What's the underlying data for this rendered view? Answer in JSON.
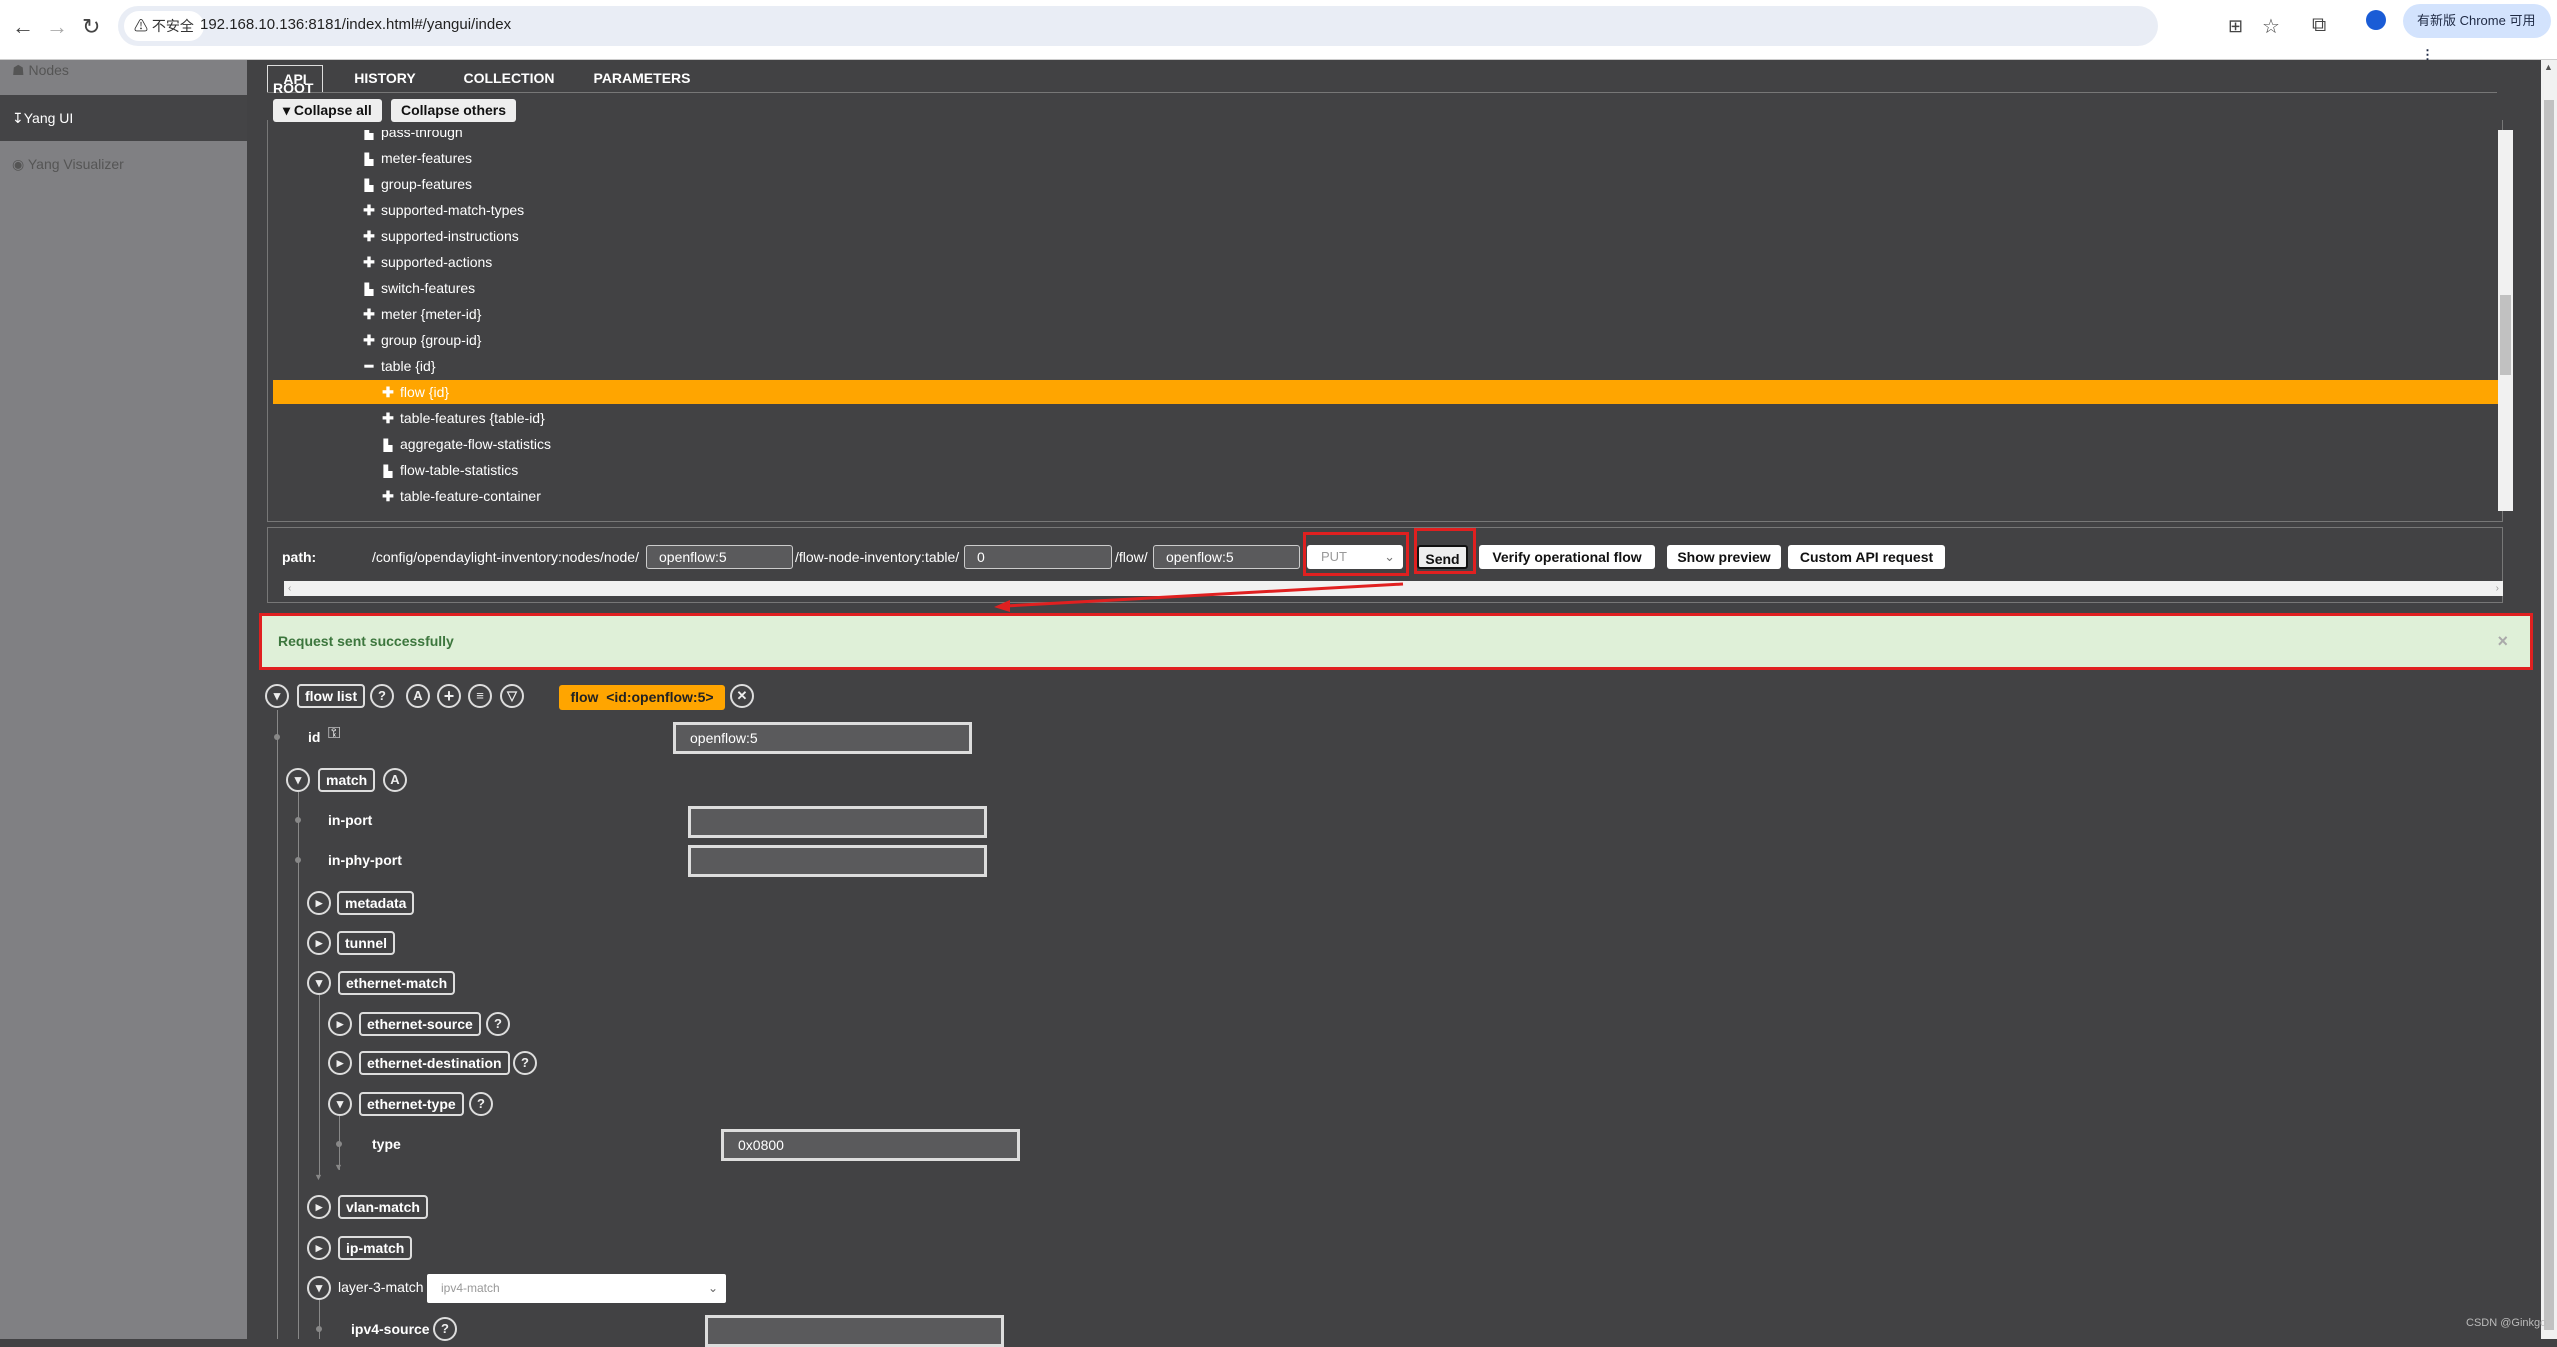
{
  "browser": {
    "security_label": "不安全",
    "url": "192.168.10.136:8181/index.html#/yangui/index",
    "update_label": "有新版 Chrome 可用"
  },
  "sidebar": {
    "items": [
      {
        "label": "Nodes",
        "icon": "sitemap-icon"
      },
      {
        "label": "Yang UI",
        "icon": "arrow-down-icon",
        "active": true
      },
      {
        "label": "Yang Visualizer",
        "icon": "eye-icon"
      }
    ]
  },
  "tabs": [
    "API",
    "HISTORY",
    "COLLECTION",
    "PARAMETERS"
  ],
  "tree": {
    "root_label": "ROOT",
    "collapse_all": "Collapse all",
    "collapse_others": "Collapse others",
    "items": [
      {
        "label": "pass-through",
        "icon": "file",
        "level": 0
      },
      {
        "label": "meter-features",
        "icon": "file",
        "level": 0
      },
      {
        "label": "group-features",
        "icon": "file",
        "level": 0
      },
      {
        "label": "supported-match-types",
        "icon": "plus",
        "level": 0
      },
      {
        "label": "supported-instructions",
        "icon": "plus",
        "level": 0
      },
      {
        "label": "supported-actions",
        "icon": "plus",
        "level": 0
      },
      {
        "label": "switch-features",
        "icon": "file",
        "level": 0
      },
      {
        "label": "meter {meter-id}",
        "icon": "plus",
        "level": 0
      },
      {
        "label": "group {group-id}",
        "icon": "plus",
        "level": 0
      },
      {
        "label": "table {id}",
        "icon": "minus",
        "level": 0
      },
      {
        "label": "flow {id}",
        "icon": "plus",
        "level": 1,
        "selected": true
      },
      {
        "label": "table-features {table-id}",
        "icon": "plus",
        "level": 1
      },
      {
        "label": "aggregate-flow-statistics",
        "icon": "file",
        "level": 1
      },
      {
        "label": "flow-table-statistics",
        "icon": "file",
        "level": 1
      },
      {
        "label": "table-feature-container",
        "icon": "plus",
        "level": 1
      }
    ]
  },
  "path": {
    "label": "path:",
    "seg1": "/config/opendaylight-inventory:nodes/node/",
    "node_id": "openflow:5",
    "seg2": "/flow-node-inventory:table/",
    "table_id": "0",
    "seg3": "/flow/",
    "flow_id": "openflow:5",
    "method": "PUT",
    "send": "Send",
    "verify": "Verify operational flow",
    "preview": "Show preview",
    "custom": "Custom API request"
  },
  "alert": {
    "message": "Request sent successfully",
    "close": "×",
    "color": "#dff0d8"
  },
  "form": {
    "flow_list": "flow list",
    "badge": "flow  <id:openflow:5>",
    "badge_color": "#ffa500",
    "id_label": "id",
    "id_value": "openflow:5",
    "match": "match",
    "in_port": "in-port",
    "in_port_value": "",
    "in_phy_port": "in-phy-port",
    "in_phy_port_value": "",
    "metadata": "metadata",
    "tunnel": "tunnel",
    "ethernet_match": "ethernet-match",
    "ethernet_source": "ethernet-source",
    "ethernet_destination": "ethernet-destination",
    "ethernet_type": "ethernet-type",
    "type_label": "type",
    "type_value": "0x0800",
    "vlan_match": "vlan-match",
    "ip_match": "ip-match",
    "layer3_label": "layer-3-match",
    "layer3_value": "ipv4-match",
    "ipv4_source": "ipv4-source",
    "ipv4_source_value": ""
  },
  "watermark": "CSDN @Ginkgo"
}
